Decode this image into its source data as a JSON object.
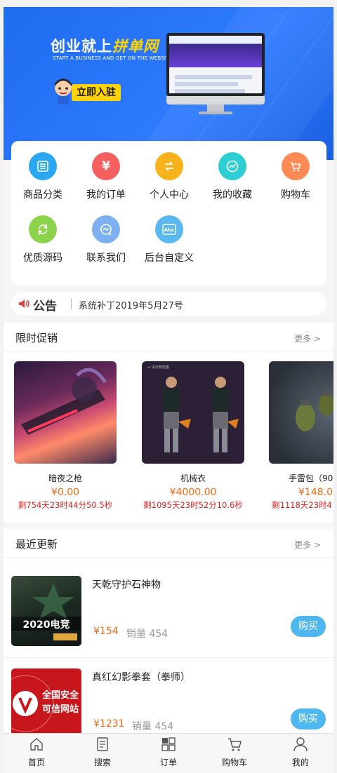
{
  "banner": {
    "title": "创业就上",
    "brand": "拼单网",
    "subtitle": "START A BUSINESS AND GET ON THE WEBSITE",
    "button": "立即入驻"
  },
  "menu": [
    {
      "label": "商品分类",
      "color": "#2aa6f2",
      "icon": "list-icon"
    },
    {
      "label": "我的订单",
      "color": "#f55f5f",
      "icon": "yen-icon"
    },
    {
      "label": "个人中心",
      "color": "#f8b31c",
      "icon": "swap-icon"
    },
    {
      "label": "我的收藏",
      "color": "#2dcfd4",
      "icon": "trend-icon"
    },
    {
      "label": "购物车",
      "color": "#ff8a56",
      "icon": "cart-icon"
    },
    {
      "label": "优质源码",
      "color": "#8bd34a",
      "icon": "refresh-icon"
    },
    {
      "label": "联系我们",
      "color": "#7cb0f0",
      "icon": "chat-icon"
    },
    {
      "label": "后台自定义",
      "color": "#5ab8f0",
      "icon": "text-icon"
    }
  ],
  "notice": {
    "title": "公告",
    "text": "系统补丁2019年5月27号"
  },
  "flash_sale": {
    "title": "限时促销",
    "more": "更多 >",
    "items": [
      {
        "name": "暗夜之枪",
        "price": "¥0.00",
        "countdown": "剩754天23时44分50.5秒"
      },
      {
        "name": "机械衣",
        "price": "¥4000.00",
        "countdown": "剩1095天23时52分10.6秒"
      },
      {
        "name": "手雷包（90",
        "price": "¥148.0",
        "countdown": "剩1118天23时4"
      }
    ]
  },
  "recent": {
    "title": "最近更新",
    "more": "更多 >",
    "items": [
      {
        "name": "天乾守护石神物",
        "price": "¥154",
        "sales_label": "销量 454",
        "buy": "购买",
        "image_text": "2020电竞"
      },
      {
        "name": "真红幻影拳套（拳师）",
        "price": "¥1231",
        "sales_label": "销量 454",
        "buy": "购买",
        "image_text": "全国安全可信网站"
      }
    ]
  },
  "tabbar": [
    {
      "label": "首页",
      "icon": "home-icon"
    },
    {
      "label": "搜索",
      "icon": "search-icon"
    },
    {
      "label": "订单",
      "icon": "grid-icon"
    },
    {
      "label": "购物车",
      "icon": "cart-icon"
    },
    {
      "label": "我的",
      "icon": "user-icon"
    }
  ]
}
